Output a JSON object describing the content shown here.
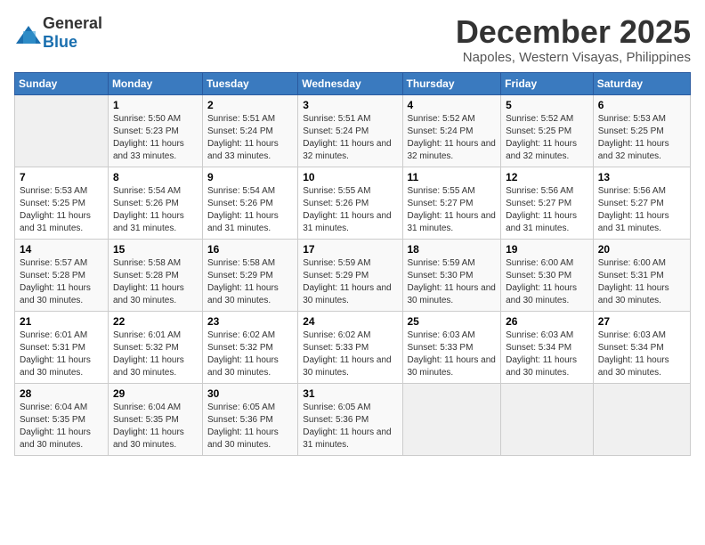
{
  "logo": {
    "general": "General",
    "blue": "Blue"
  },
  "title": "December 2025",
  "location": "Napoles, Western Visayas, Philippines",
  "headers": [
    "Sunday",
    "Monday",
    "Tuesday",
    "Wednesday",
    "Thursday",
    "Friday",
    "Saturday"
  ],
  "weeks": [
    [
      {
        "day": "",
        "sunrise": "",
        "sunset": "",
        "daylight": ""
      },
      {
        "day": "1",
        "sunrise": "Sunrise: 5:50 AM",
        "sunset": "Sunset: 5:23 PM",
        "daylight": "Daylight: 11 hours and 33 minutes."
      },
      {
        "day": "2",
        "sunrise": "Sunrise: 5:51 AM",
        "sunset": "Sunset: 5:24 PM",
        "daylight": "Daylight: 11 hours and 33 minutes."
      },
      {
        "day": "3",
        "sunrise": "Sunrise: 5:51 AM",
        "sunset": "Sunset: 5:24 PM",
        "daylight": "Daylight: 11 hours and 32 minutes."
      },
      {
        "day": "4",
        "sunrise": "Sunrise: 5:52 AM",
        "sunset": "Sunset: 5:24 PM",
        "daylight": "Daylight: 11 hours and 32 minutes."
      },
      {
        "day": "5",
        "sunrise": "Sunrise: 5:52 AM",
        "sunset": "Sunset: 5:25 PM",
        "daylight": "Daylight: 11 hours and 32 minutes."
      },
      {
        "day": "6",
        "sunrise": "Sunrise: 5:53 AM",
        "sunset": "Sunset: 5:25 PM",
        "daylight": "Daylight: 11 hours and 32 minutes."
      }
    ],
    [
      {
        "day": "7",
        "sunrise": "Sunrise: 5:53 AM",
        "sunset": "Sunset: 5:25 PM",
        "daylight": "Daylight: 11 hours and 31 minutes."
      },
      {
        "day": "8",
        "sunrise": "Sunrise: 5:54 AM",
        "sunset": "Sunset: 5:26 PM",
        "daylight": "Daylight: 11 hours and 31 minutes."
      },
      {
        "day": "9",
        "sunrise": "Sunrise: 5:54 AM",
        "sunset": "Sunset: 5:26 PM",
        "daylight": "Daylight: 11 hours and 31 minutes."
      },
      {
        "day": "10",
        "sunrise": "Sunrise: 5:55 AM",
        "sunset": "Sunset: 5:26 PM",
        "daylight": "Daylight: 11 hours and 31 minutes."
      },
      {
        "day": "11",
        "sunrise": "Sunrise: 5:55 AM",
        "sunset": "Sunset: 5:27 PM",
        "daylight": "Daylight: 11 hours and 31 minutes."
      },
      {
        "day": "12",
        "sunrise": "Sunrise: 5:56 AM",
        "sunset": "Sunset: 5:27 PM",
        "daylight": "Daylight: 11 hours and 31 minutes."
      },
      {
        "day": "13",
        "sunrise": "Sunrise: 5:56 AM",
        "sunset": "Sunset: 5:27 PM",
        "daylight": "Daylight: 11 hours and 31 minutes."
      }
    ],
    [
      {
        "day": "14",
        "sunrise": "Sunrise: 5:57 AM",
        "sunset": "Sunset: 5:28 PM",
        "daylight": "Daylight: 11 hours and 30 minutes."
      },
      {
        "day": "15",
        "sunrise": "Sunrise: 5:58 AM",
        "sunset": "Sunset: 5:28 PM",
        "daylight": "Daylight: 11 hours and 30 minutes."
      },
      {
        "day": "16",
        "sunrise": "Sunrise: 5:58 AM",
        "sunset": "Sunset: 5:29 PM",
        "daylight": "Daylight: 11 hours and 30 minutes."
      },
      {
        "day": "17",
        "sunrise": "Sunrise: 5:59 AM",
        "sunset": "Sunset: 5:29 PM",
        "daylight": "Daylight: 11 hours and 30 minutes."
      },
      {
        "day": "18",
        "sunrise": "Sunrise: 5:59 AM",
        "sunset": "Sunset: 5:30 PM",
        "daylight": "Daylight: 11 hours and 30 minutes."
      },
      {
        "day": "19",
        "sunrise": "Sunrise: 6:00 AM",
        "sunset": "Sunset: 5:30 PM",
        "daylight": "Daylight: 11 hours and 30 minutes."
      },
      {
        "day": "20",
        "sunrise": "Sunrise: 6:00 AM",
        "sunset": "Sunset: 5:31 PM",
        "daylight": "Daylight: 11 hours and 30 minutes."
      }
    ],
    [
      {
        "day": "21",
        "sunrise": "Sunrise: 6:01 AM",
        "sunset": "Sunset: 5:31 PM",
        "daylight": "Daylight: 11 hours and 30 minutes."
      },
      {
        "day": "22",
        "sunrise": "Sunrise: 6:01 AM",
        "sunset": "Sunset: 5:32 PM",
        "daylight": "Daylight: 11 hours and 30 minutes."
      },
      {
        "day": "23",
        "sunrise": "Sunrise: 6:02 AM",
        "sunset": "Sunset: 5:32 PM",
        "daylight": "Daylight: 11 hours and 30 minutes."
      },
      {
        "day": "24",
        "sunrise": "Sunrise: 6:02 AM",
        "sunset": "Sunset: 5:33 PM",
        "daylight": "Daylight: 11 hours and 30 minutes."
      },
      {
        "day": "25",
        "sunrise": "Sunrise: 6:03 AM",
        "sunset": "Sunset: 5:33 PM",
        "daylight": "Daylight: 11 hours and 30 minutes."
      },
      {
        "day": "26",
        "sunrise": "Sunrise: 6:03 AM",
        "sunset": "Sunset: 5:34 PM",
        "daylight": "Daylight: 11 hours and 30 minutes."
      },
      {
        "day": "27",
        "sunrise": "Sunrise: 6:03 AM",
        "sunset": "Sunset: 5:34 PM",
        "daylight": "Daylight: 11 hours and 30 minutes."
      }
    ],
    [
      {
        "day": "28",
        "sunrise": "Sunrise: 6:04 AM",
        "sunset": "Sunset: 5:35 PM",
        "daylight": "Daylight: 11 hours and 30 minutes."
      },
      {
        "day": "29",
        "sunrise": "Sunrise: 6:04 AM",
        "sunset": "Sunset: 5:35 PM",
        "daylight": "Daylight: 11 hours and 30 minutes."
      },
      {
        "day": "30",
        "sunrise": "Sunrise: 6:05 AM",
        "sunset": "Sunset: 5:36 PM",
        "daylight": "Daylight: 11 hours and 30 minutes."
      },
      {
        "day": "31",
        "sunrise": "Sunrise: 6:05 AM",
        "sunset": "Sunset: 5:36 PM",
        "daylight": "Daylight: 11 hours and 31 minutes."
      },
      {
        "day": "",
        "sunrise": "",
        "sunset": "",
        "daylight": ""
      },
      {
        "day": "",
        "sunrise": "",
        "sunset": "",
        "daylight": ""
      },
      {
        "day": "",
        "sunrise": "",
        "sunset": "",
        "daylight": ""
      }
    ]
  ]
}
